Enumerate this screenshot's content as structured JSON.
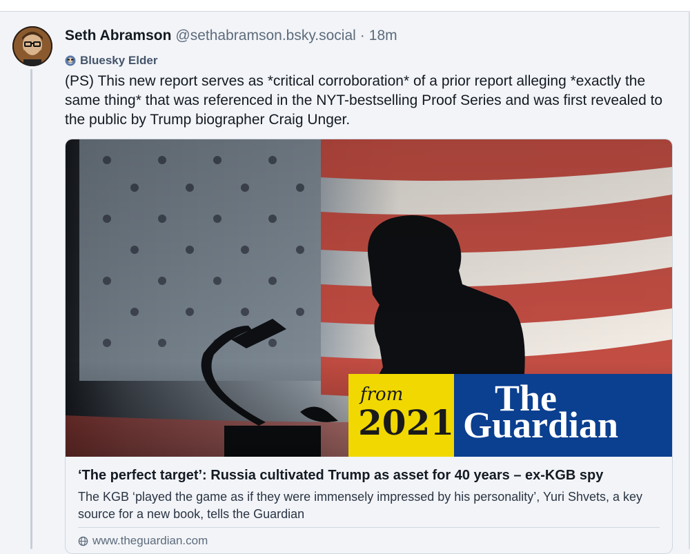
{
  "post": {
    "author_name": "Seth Abramson",
    "author_handle": "@sethabramson.bsky.social",
    "separator": "·",
    "time_ago": "18m",
    "badge_label": "Bluesky Elder",
    "text": "(PS) This new report serves as *critical corroboration* of a prior report alleging *exactly the same thing* that was referenced in the NYT-bestselling Proof Series and was first revealed to the public by Trump biographer Craig Unger."
  },
  "link_card": {
    "image_overlay": {
      "from_text": "from",
      "year_text": "2021",
      "brand_line1": "The",
      "brand_line2": "Guardian"
    },
    "title": "‘The perfect target’: Russia cultivated Trump as asset for 40 years – ex-KGB spy",
    "description": "The KGB ‘played the game as if they were immensely impressed by his personality’, Yuri Shvets, a key source for a new book, tells the Guardian",
    "domain": "www.theguardian.com",
    "domain_icon": "globe-icon"
  },
  "colors": {
    "background": "#f2f4f8",
    "guardian_blue": "#0b3f8f",
    "badge_yellow": "#f0d800",
    "flag_red": "#c0463c"
  }
}
